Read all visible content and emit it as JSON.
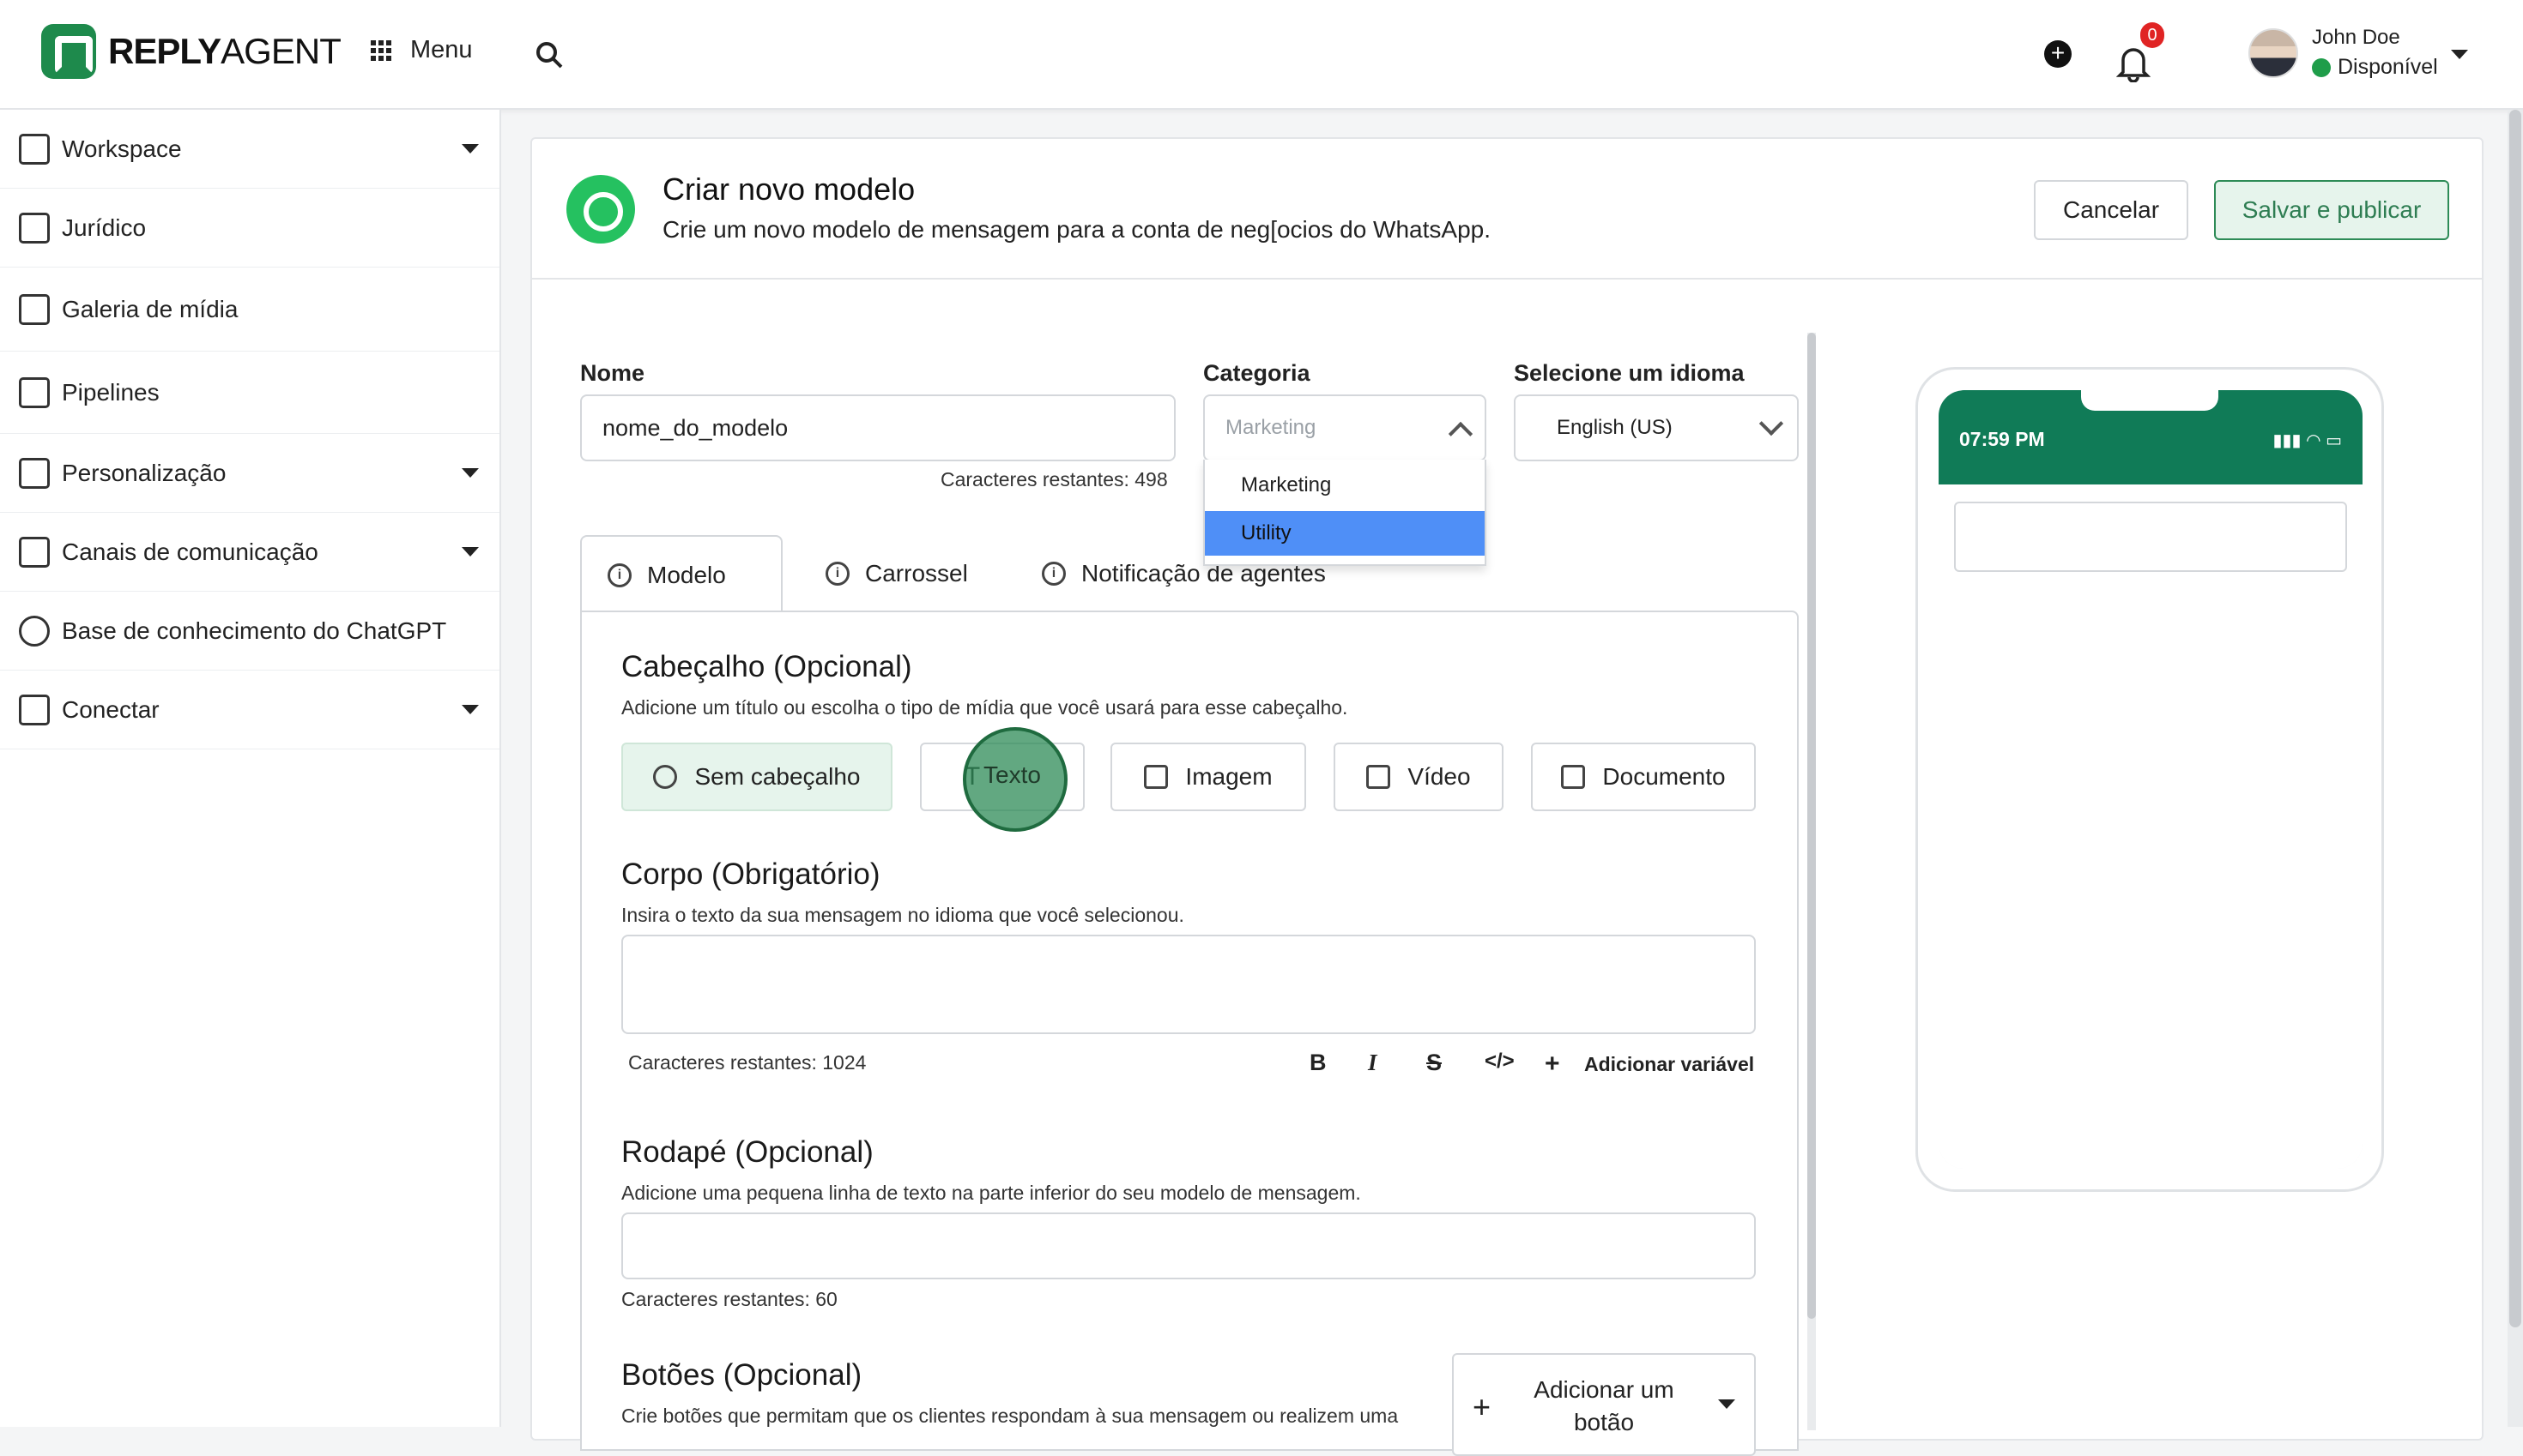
{
  "header": {
    "logo_bold": "REPLY",
    "logo_light": "AGENT",
    "menu_label": "Menu",
    "notification_count": "0",
    "user_name": "John Doe",
    "user_status": "Disponível"
  },
  "sidebar": {
    "items": [
      {
        "label": "Workspace"
      },
      {
        "label": "Jurídico"
      },
      {
        "label": "Galeria de mídia"
      },
      {
        "label": "Pipelines"
      },
      {
        "label": "Personalização"
      },
      {
        "label": "Canais de comunicação"
      },
      {
        "label": "Base de conhecimento do ChatGPT"
      },
      {
        "label": "Conectar"
      }
    ]
  },
  "card": {
    "title": "Criar novo modelo",
    "subtitle": "Crie um novo modelo de mensagem para a conta de neg[ocios do WhatsApp.",
    "cancel_label": "Cancelar",
    "save_label": "Salvar e publicar"
  },
  "form": {
    "name_label": "Nome",
    "name_value": "nome_do_modelo",
    "name_remaining": "Caracteres restantes: 498",
    "category_label": "Categoria",
    "category_placeholder": "Marketing",
    "category_options": [
      "Marketing",
      "Utility"
    ],
    "category_highlighted": "Utility",
    "language_label": "Selecione um idioma",
    "language_value": "English (US)"
  },
  "tabs": [
    {
      "label": "Modelo"
    },
    {
      "label": "Carrossel"
    },
    {
      "label": "Notificação de agentes"
    }
  ],
  "header_section": {
    "title": "Cabeçalho (Opcional)",
    "desc": "Adicione um título ou escolha o tipo de mídia que você usará para esse cabeçalho.",
    "options": [
      "Sem cabeçalho",
      "Texto",
      "Imagem",
      "Vídeo",
      "Documento"
    ]
  },
  "body_section": {
    "title": "Corpo (Obrigatório)",
    "desc": "Insira o texto da sua mensagem no idioma que você selecionou.",
    "remaining": "Caracteres restantes: 1024",
    "add_variable": "Adicionar variável"
  },
  "footer_section": {
    "title": "Rodapé (Opcional)",
    "desc": "Adicione uma pequena linha de texto na parte inferior do seu modelo de mensagem.",
    "remaining": "Caracteres restantes: 60"
  },
  "buttons_section": {
    "title": "Botões (Opcional)",
    "desc": "Crie botões que permitam que os clientes respondam à sua mensagem ou realizem uma",
    "add_button": "Adicionar um botão"
  },
  "preview": {
    "time": "07:59 PM"
  },
  "colors": {
    "brand_green": "#1e8a4c",
    "whatsapp_header": "#107b57",
    "highlight_blue": "#4f8ff7",
    "badge_red": "#e02424"
  }
}
